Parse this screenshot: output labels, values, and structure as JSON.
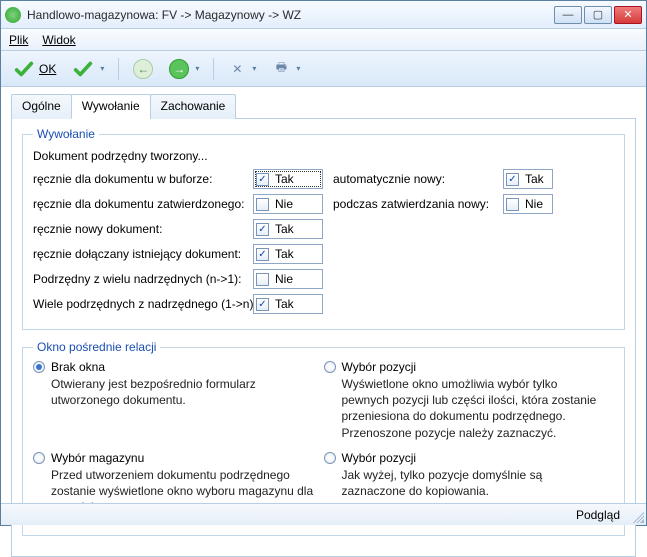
{
  "window": {
    "title": "Handlowo-magazynowa: FV -> Magazynowy -> WZ"
  },
  "menu": {
    "file": "Plik",
    "view": "Widok"
  },
  "toolbar": {
    "ok": "OK"
  },
  "tabs": {
    "general": "Ogólne",
    "invocation": "Wywołanie",
    "behavior": "Zachowanie"
  },
  "group1": {
    "legend": "Wywołanie",
    "heading": "Dokument podrzędny tworzony...",
    "rows": {
      "r1l": "ręcznie dla dokumentu w buforze:",
      "r1r": "automatycznie nowy:",
      "r2l": "ręcznie dla dokumentu zatwierdzonego:",
      "r2r": "podczas zatwierdzania nowy:",
      "r3l": "ręcznie nowy dokument:",
      "r4l": "ręcznie dołączany istniejący dokument:",
      "r5l": "Podrzędny z wielu nadrzędnych (n->1):",
      "r6l": "Wiele podrzędnych z nadrzędnego (1->n):"
    },
    "vals": {
      "yes": "Tak",
      "no": "Nie"
    }
  },
  "group2": {
    "legend": "Okno pośrednie relacji",
    "opts": {
      "o1t": "Brak okna",
      "o1d": "Otwierany jest bezpośrednio formularz utworzonego dokumentu.",
      "o2t": "Wybór pozycji",
      "o2d": "Wyświetlone okno umożliwia wybór tylko pewnych pozycji lub części ilości, która zostanie przeniesiona do dokumentu podrzędnego. Przenoszone pozycje należy zaznaczyć.",
      "o3t": "Wybór magazynu",
      "o3d": "Przed utworzeniem dokumentu podrzędnego zostanie wyświetlone okno wyboru magazynu dla tego dokumentu.",
      "o4t": "Wybór pozycji",
      "o4d": "Jak wyżej, tylko pozycje domyślnie są zaznaczone do kopiowania."
    }
  },
  "status": {
    "preview": "Podgląd"
  }
}
